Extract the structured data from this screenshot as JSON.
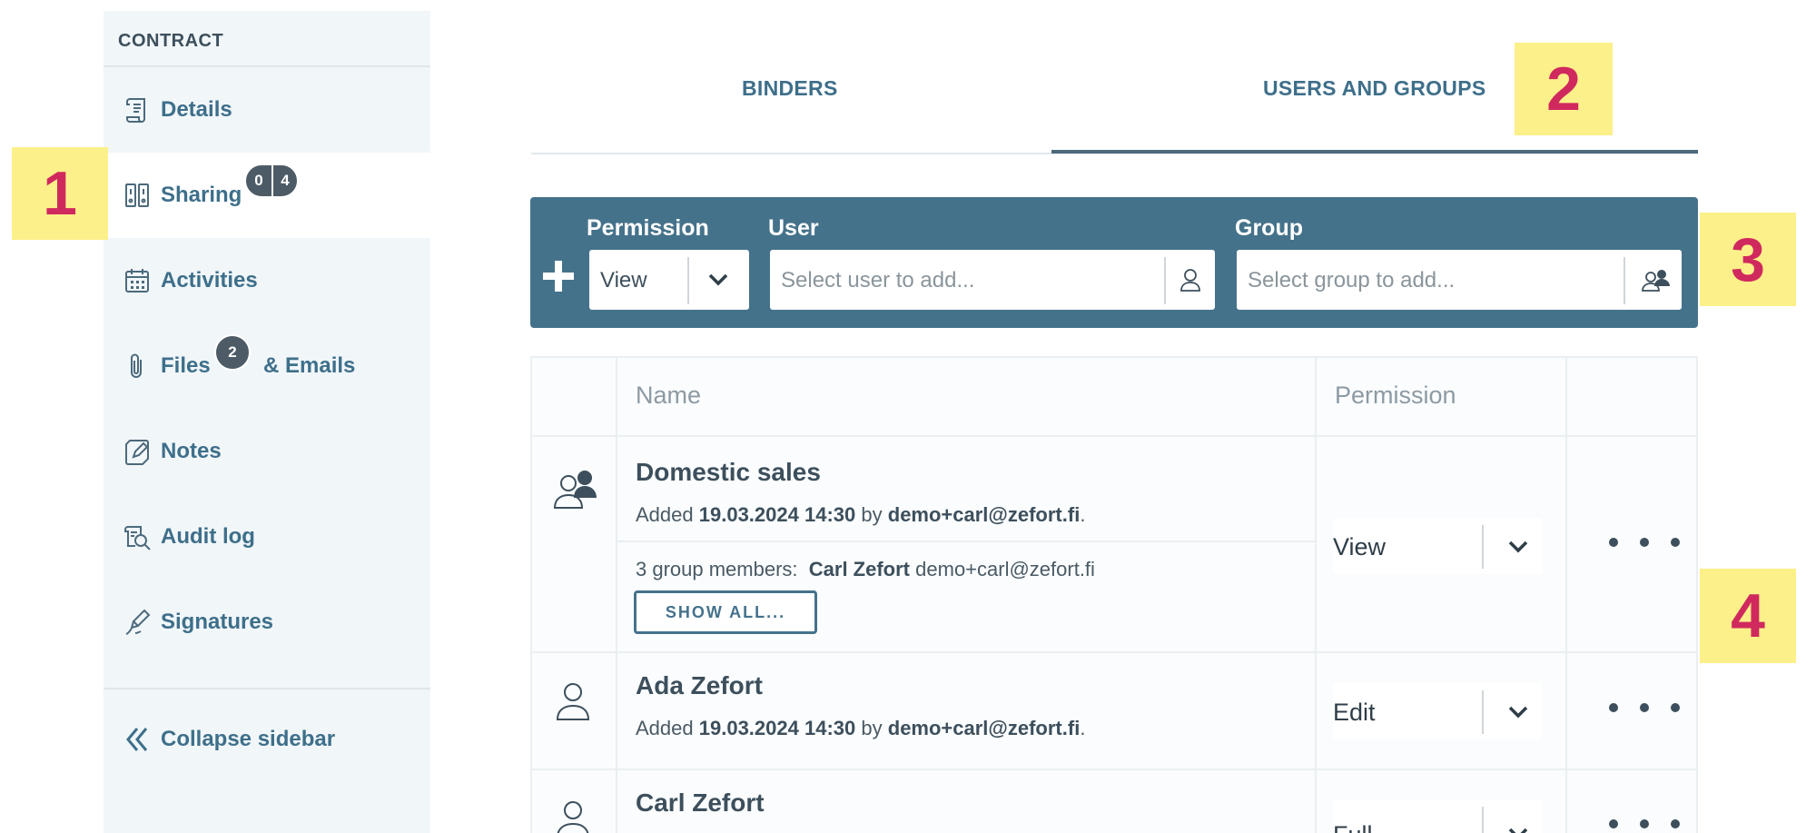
{
  "sidebar": {
    "header": "CONTRACT",
    "items": [
      {
        "label": "Details",
        "icon": "scroll-icon"
      },
      {
        "label": "Sharing",
        "icon": "binders-icon",
        "badge_left": "0",
        "badge_right": "4"
      },
      {
        "label": "Activities",
        "icon": "calendar-icon"
      },
      {
        "label": "Files",
        "label_suffix": "& Emails",
        "icon": "paperclip-icon",
        "badge": "2"
      },
      {
        "label": "Notes",
        "icon": "note-edit-icon"
      },
      {
        "label": "Audit log",
        "icon": "audit-search-icon"
      },
      {
        "label": "Signatures",
        "icon": "pen-icon"
      }
    ],
    "collapse_label": "Collapse sidebar"
  },
  "callouts": [
    "1",
    "2",
    "3",
    "4"
  ],
  "tabs": {
    "binders": "BINDERS",
    "users_groups": "USERS AND GROUPS",
    "active": "users_groups"
  },
  "addbar": {
    "permission_label": "Permission",
    "permission_value": "View",
    "user_label": "User",
    "user_placeholder": "Select user to add...",
    "group_label": "Group",
    "group_placeholder": "Select group to add..."
  },
  "table": {
    "headers": {
      "name": "Name",
      "permission": "Permission"
    },
    "rows": [
      {
        "type": "group",
        "name": "Domestic sales",
        "added_prefix": "Added",
        "added_date": "19.03.2024 14:30",
        "by": "by",
        "added_by": "demo+carl@zefort.fi",
        "members_label": "3 group members:",
        "member_name": "Carl Zefort",
        "member_email": "demo+carl@zefort.fi",
        "show_all": "SHOW ALL...",
        "permission": "View"
      },
      {
        "type": "user",
        "name": "Ada Zefort",
        "added_prefix": "Added",
        "added_date": "19.03.2024 14:30",
        "by": "by",
        "added_by": "demo+carl@zefort.fi",
        "permission": "Edit"
      },
      {
        "type": "user",
        "name": "Carl Zefort",
        "permission": "Full"
      }
    ]
  },
  "colors": {
    "accent": "#45728b",
    "link": "#3e6f8a",
    "callout_bg": "#fbf08a",
    "callout_text": "#d0295e",
    "sidebar_bg": "#f1f6f9"
  }
}
